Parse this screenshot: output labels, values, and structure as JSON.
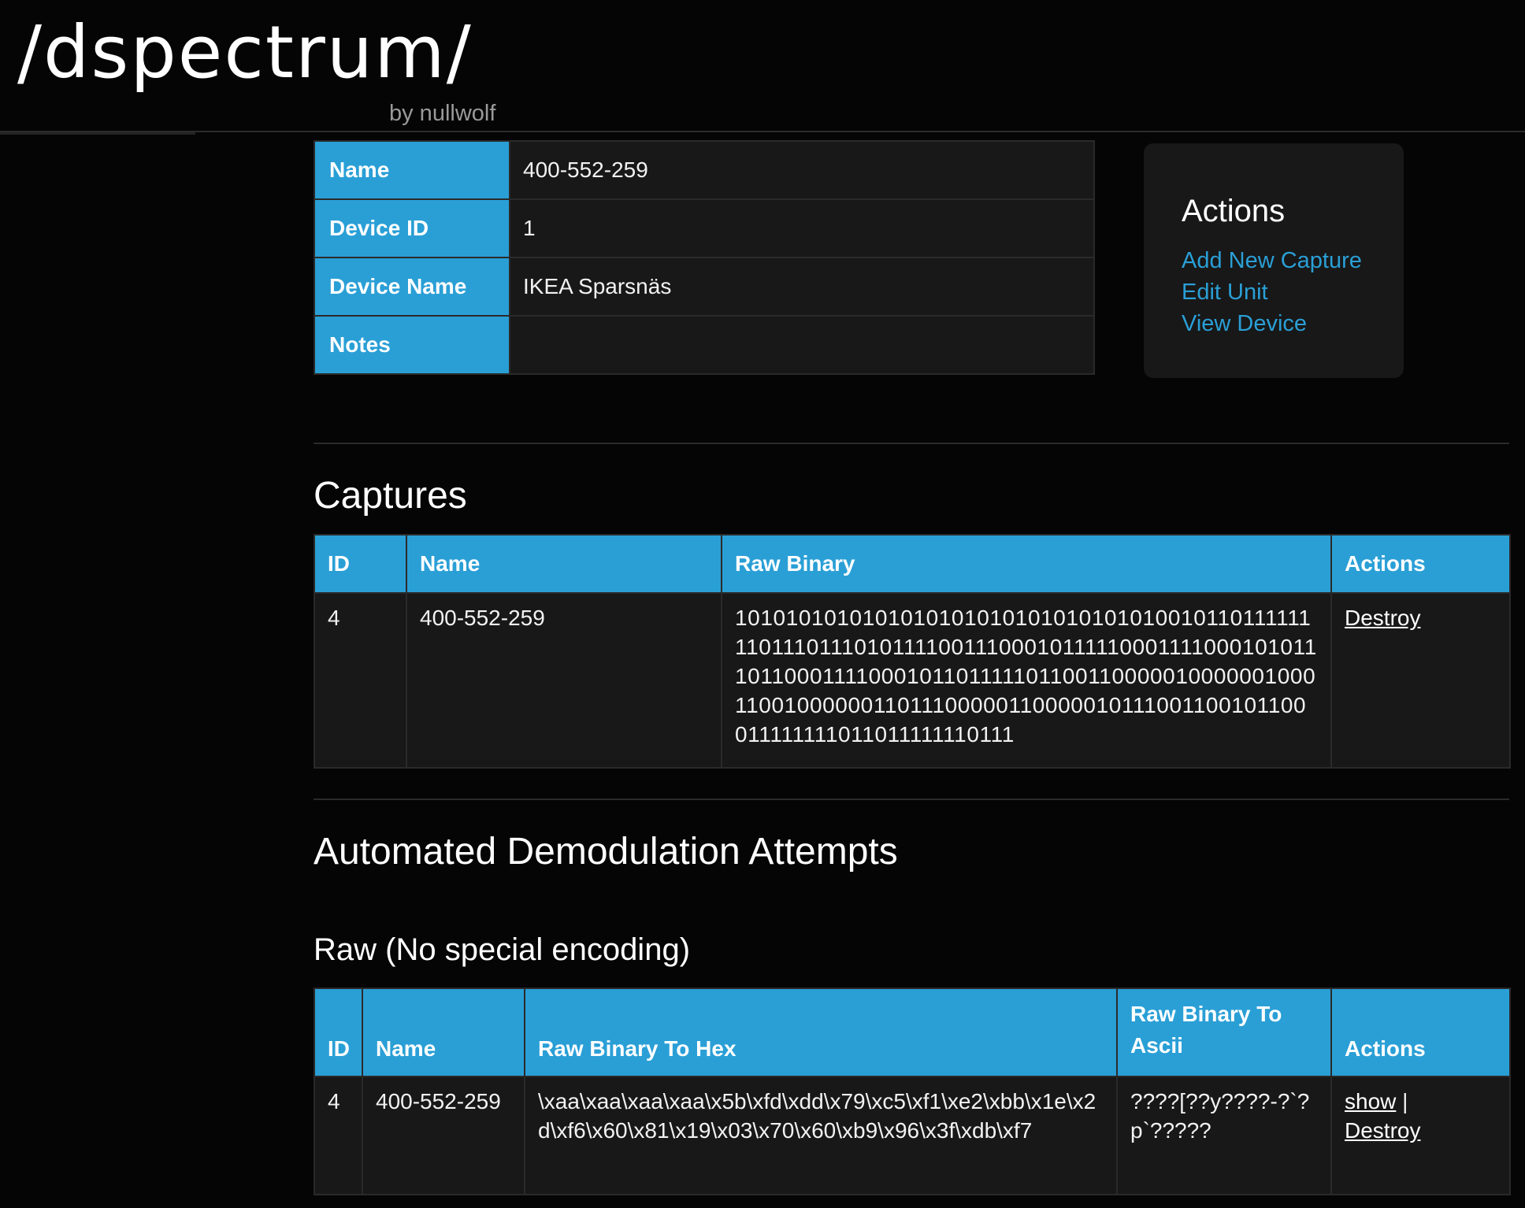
{
  "header": {
    "logo_text": "/dspectrum/",
    "byline": "by nullwolf"
  },
  "unit": {
    "rows": [
      {
        "label": "Name",
        "value": "400-552-259"
      },
      {
        "label": "Device ID",
        "value": "1"
      },
      {
        "label": "Device Name",
        "value": "IKEA Sparsnäs"
      },
      {
        "label": "Notes",
        "value": ""
      }
    ]
  },
  "actions_panel": {
    "title": "Actions",
    "links": [
      "Add New Capture",
      "Edit Unit",
      "View Device"
    ]
  },
  "captures": {
    "title": "Captures",
    "headers": [
      "ID",
      "Name",
      "Raw Binary",
      "Actions"
    ],
    "rows": [
      {
        "id": "4",
        "name": "400-552-259",
        "raw_binary": "1010101010101010101010101010101010010110111111110111011101011110011100010111110001111000101011101100011110001011011111011001100000100000010001100100000011011100000110000010111001100101100011111111011011111110111",
        "action": "Destroy"
      }
    ]
  },
  "demod": {
    "title": "Automated Demodulation Attempts",
    "raw_title": "Raw (No special encoding)",
    "headers": [
      "ID",
      "Name",
      "Raw Binary To Hex",
      "Raw Binary To Ascii",
      "Actions"
    ],
    "rows": [
      {
        "id": "4",
        "name": "400-552-259",
        "hex": "\\xaa\\xaa\\xaa\\xaa\\x5b\\xfd\\xdd\\x79\\xc5\\xf1\\xe2\\xbb\\x1e\\x2d\\xf6\\x60\\x81\\x19\\x03\\x70\\x60\\xb9\\x96\\x3f\\xdb\\xf7",
        "ascii": "????[??y????-?`?p`?????",
        "action_show": "show",
        "action_sep": "|",
        "action_destroy": "Destroy"
      }
    ]
  }
}
